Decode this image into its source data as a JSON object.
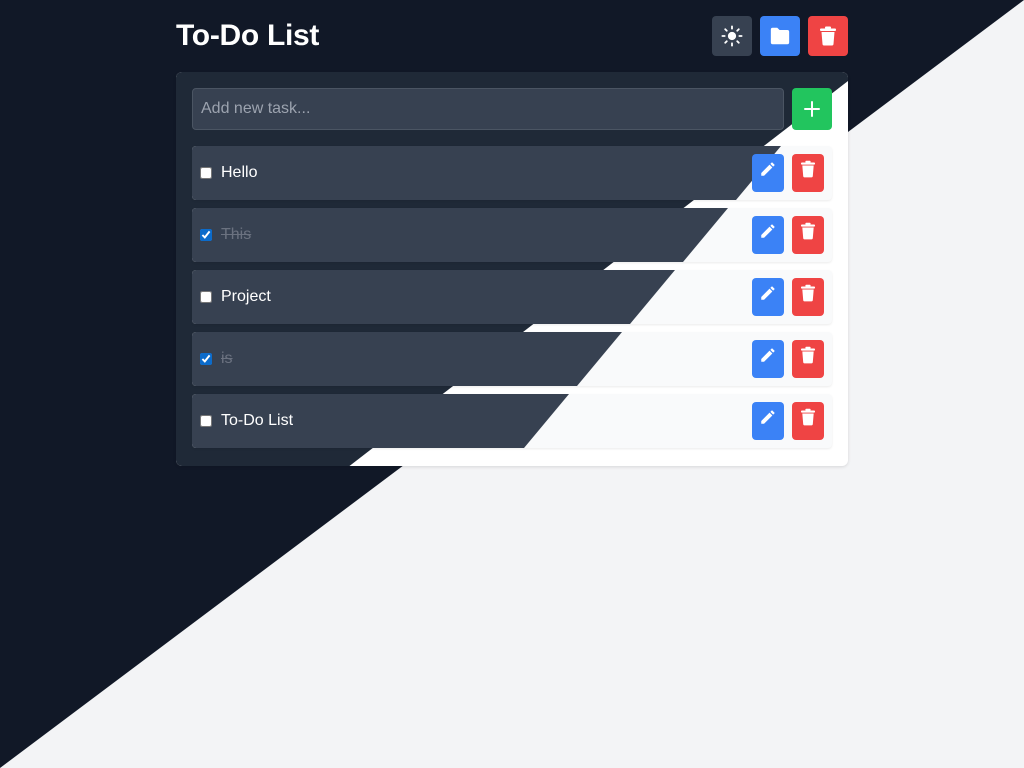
{
  "header": {
    "title": "To-Do List",
    "buttons": [
      {
        "name": "theme-toggle",
        "icon": "sun-icon"
      },
      {
        "name": "folder",
        "icon": "folder-icon"
      },
      {
        "name": "clear-all",
        "icon": "trash-icon"
      }
    ]
  },
  "add_task": {
    "placeholder": "Add new task...",
    "value": "",
    "button_icon": "plus-icon"
  },
  "tasks": [
    {
      "text": "Hello",
      "completed": false
    },
    {
      "text": "This",
      "completed": true
    },
    {
      "text": "Project",
      "completed": false
    },
    {
      "text": "is",
      "completed": true
    },
    {
      "text": "To-Do List",
      "completed": false
    }
  ],
  "colors": {
    "page_dark": "#111827",
    "page_light": "#f3f4f6",
    "card_dark": "#1f2937",
    "task_dark": "#374151",
    "primary": "#3b82f6",
    "danger": "#ef4444",
    "success": "#22c55e"
  }
}
